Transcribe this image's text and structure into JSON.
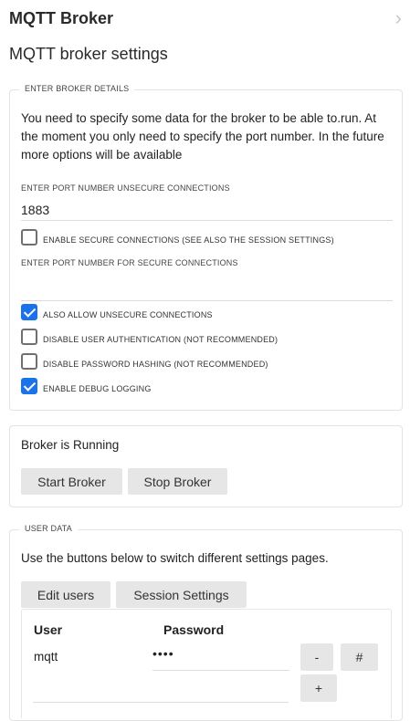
{
  "header": {
    "title": "MQTT Broker",
    "chevron_icon": "chevron-right-icon"
  },
  "subtitle": "MQTT broker settings",
  "broker_details": {
    "legend": "ENTER BROKER DETAILS",
    "intro": "You need to specify some data for the broker to be able to.run. At the moment you only need to specify the port number. In the future more options will be available",
    "port_unsecure_label": "ENTER PORT NUMBER UNSECURE CONNECTIONS",
    "port_unsecure_value": "1883",
    "enable_secure": {
      "label": "ENABLE SECURE CONNECTIONS (SEE ALSO THE SESSION SETTINGS)",
      "checked": false
    },
    "port_secure_label": "ENTER PORT NUMBER FOR SECURE CONNECTIONS",
    "port_secure_value": "",
    "allow_unsecure": {
      "label": "ALSO ALLOW UNSECURE CONNECTIONS",
      "checked": true
    },
    "disable_auth": {
      "label": "DISABLE USER AUTHENTICATION (NOT RECOMMENDED)",
      "checked": false
    },
    "disable_hashing": {
      "label": "DISABLE PASSWORD HASHING (NOT RECOMMENDED)",
      "checked": false
    },
    "debug_logging": {
      "label": "ENABLE DEBUG LOGGING",
      "checked": true
    }
  },
  "status_panel": {
    "status_text": "Broker is Running",
    "start_label": "Start Broker",
    "stop_label": "Stop Broker"
  },
  "user_data": {
    "legend": "USER DATA",
    "intro": "Use the buttons below to switch different settings pages.",
    "edit_users_label": "Edit users",
    "session_settings_label": "Session Settings",
    "table": {
      "col_user": "User",
      "col_password": "Password",
      "rows": [
        {
          "user": "mqtt",
          "password": "••••"
        }
      ],
      "remove_label": "-",
      "hash_label": "#",
      "add_label": "+"
    }
  },
  "colors": {
    "accent": "#1a73e8",
    "button_bg": "#e6e6e6",
    "border": "#e3e3e3"
  }
}
